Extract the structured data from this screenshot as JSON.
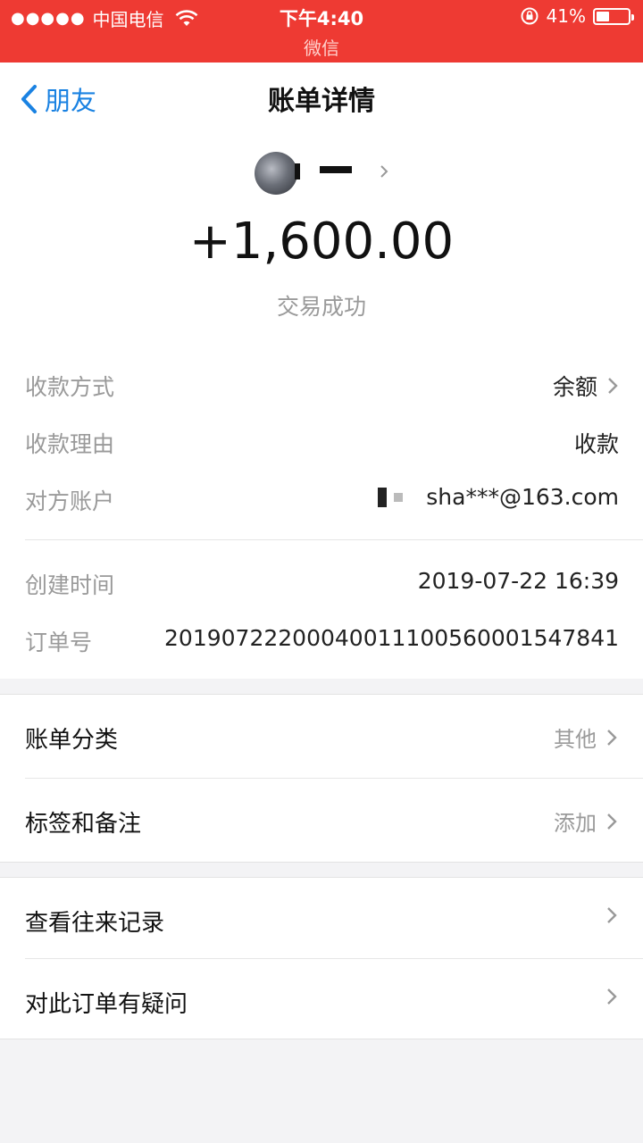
{
  "status_bar": {
    "signal_dots": "●●●●●",
    "carrier": "中国电信",
    "time": "下午4:40",
    "app_name": "微信",
    "battery_percent": "41%",
    "battery_level": 0.41
  },
  "nav": {
    "back_label": "朋友",
    "title": "账单详情"
  },
  "header": {
    "amount": "+1,600.00",
    "status": "交易成功"
  },
  "details": {
    "method_label": "收款方式",
    "method_value": "余额",
    "reason_label": "收款理由",
    "reason_value": "收款",
    "account_label": "对方账户",
    "account_value": "sha***@163.com",
    "created_label": "创建时间",
    "created_value": "2019-07-22 16:39",
    "order_label": "订单号",
    "order_value": "20190722200040011100560001547841"
  },
  "menu1": {
    "category_label": "账单分类",
    "category_value": "其他",
    "tags_label": "标签和备注",
    "tags_value": "添加"
  },
  "menu2": {
    "history_label": "查看往来记录",
    "question_label": "对此订单有疑问"
  },
  "colors": {
    "status_bar": "#ee3a33",
    "link": "#1a82e2"
  }
}
